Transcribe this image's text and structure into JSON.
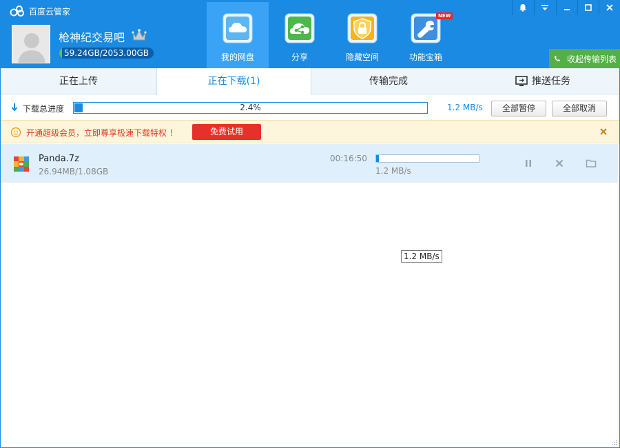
{
  "app": {
    "title": "百度云管家"
  },
  "user": {
    "name": "枪神纪交易吧",
    "storage_text": "59.24GB/2053.00GB",
    "storage_fraction": 0.029
  },
  "nav": [
    {
      "label": "我的网盘",
      "icon": "cloud-icon",
      "active": true
    },
    {
      "label": "分享",
      "icon": "share-icon",
      "active": false
    },
    {
      "label": "隐藏空间",
      "icon": "lock-icon",
      "active": false
    },
    {
      "label": "功能宝箱",
      "icon": "wrench-icon",
      "active": false,
      "badge": "NEW"
    }
  ],
  "window_controls": [
    "bell-icon",
    "menu-icon",
    "minimize-icon",
    "maximize-icon",
    "close-icon"
  ],
  "collapse_label": "收起传输列表",
  "tabs": [
    {
      "label": "正在上传",
      "active": false
    },
    {
      "label": "正在下载(1)",
      "active": true
    },
    {
      "label": "传输完成",
      "active": false
    },
    {
      "label": "推送任务",
      "active": false
    }
  ],
  "total": {
    "label": "下载总进度",
    "percent_text": "2.4%",
    "percent": 2.4,
    "speed": "1.2 MB/s",
    "pause_all": "全部暂停",
    "cancel_all": "全部取消"
  },
  "banner": {
    "text": "开通超级会员，立即尊享极速下载特权 ！",
    "button": "免费试用"
  },
  "tasks": [
    {
      "name": "Panda.7z",
      "size": "26.94MB/1.08GB",
      "time": "00:16:50",
      "speed": "1.2 MB/s",
      "progress": 0.024
    }
  ],
  "tooltip": "1.2 MB/s",
  "colors": {
    "primary": "#1a8ae2",
    "active_nav": "#3aa3f5",
    "green": "#52b045",
    "red": "#e5312b"
  }
}
